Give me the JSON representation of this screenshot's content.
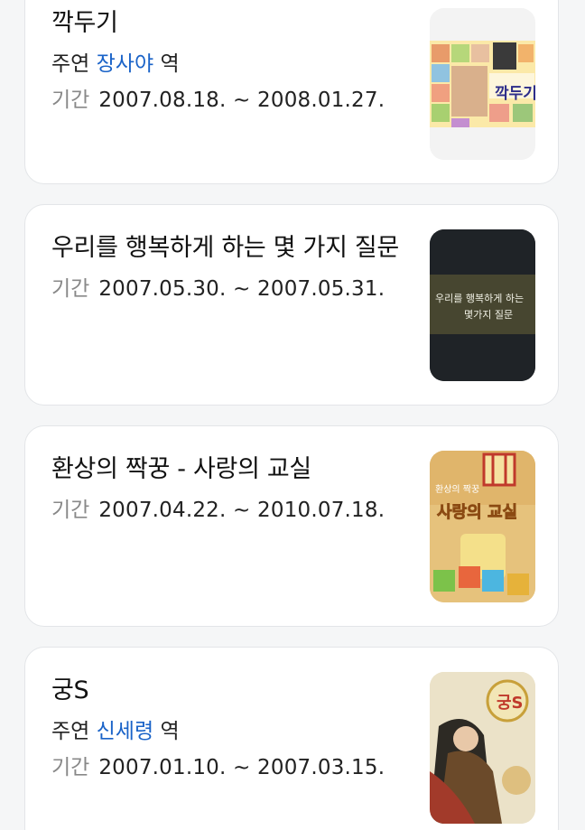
{
  "items": [
    {
      "title": "깍두기",
      "cast_label": "주연",
      "cast_name": "장사야",
      "cast_suffix": "역",
      "period_label": "기간",
      "period": "2007.08.18. ~ 2008.01.27.",
      "poster_text": "깍두기"
    },
    {
      "title": "우리를 행복하게 하는 몇 가지 질문",
      "period_label": "기간",
      "period": "2007.05.30. ~ 2007.05.31.",
      "poster_text_1": "우리를 행복하게 하는",
      "poster_text_2": "몇가지 질문"
    },
    {
      "title": "환상의 짝꿍 - 사랑의 교실",
      "period_label": "기간",
      "period": "2007.04.22. ~ 2010.07.18.",
      "poster_text_1": "환상의 짝꿍",
      "poster_text_2": "사랑의 교실"
    },
    {
      "title": "궁S",
      "cast_label": "주연",
      "cast_name": "신세령",
      "cast_suffix": "역",
      "period_label": "기간",
      "period": "2007.01.10. ~ 2007.03.15.",
      "poster_text": "궁S"
    }
  ],
  "colors": {
    "link": "#1a63c8",
    "label": "#888888",
    "text": "#111111"
  }
}
